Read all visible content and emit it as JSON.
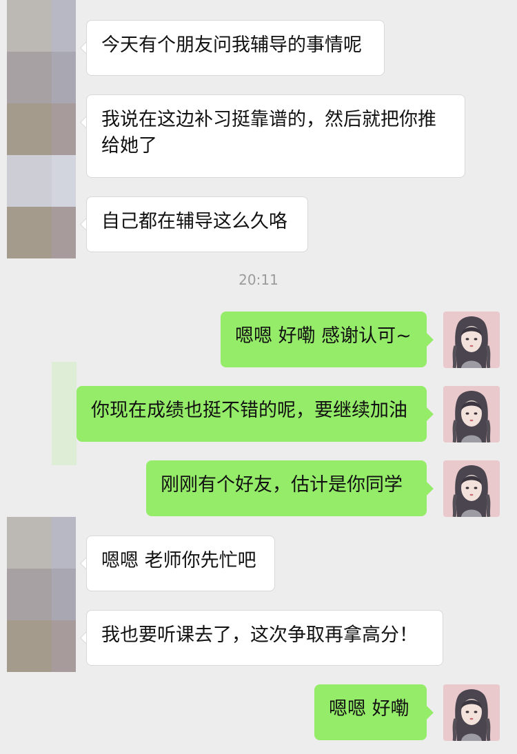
{
  "chat": {
    "messages": [
      {
        "side": "left",
        "text": "今天有个朋友问我辅导的事情呢"
      },
      {
        "side": "left",
        "text": "我说在这边补习挺靠谱的，然后就把你推给她了"
      },
      {
        "side": "left",
        "text": "自己都在辅导这么久咯"
      },
      {
        "side": "right",
        "text": "嗯嗯 好嘞 感谢认可~"
      },
      {
        "side": "right",
        "text": "你现在成绩也挺不错的呢，要继续加油"
      },
      {
        "side": "right",
        "text": "刚刚有个好友，估计是你同学"
      },
      {
        "side": "left",
        "text": "嗯嗯 老师你先忙吧"
      },
      {
        "side": "left",
        "text": "我也要听课去了，这次争取再拿高分！"
      },
      {
        "side": "right",
        "text": "嗯嗯 好嘞"
      }
    ],
    "timestamp": "20:11"
  },
  "colors": {
    "background": "#ededed",
    "left_bubble": "#ffffff",
    "right_bubble": "#95ec69"
  }
}
